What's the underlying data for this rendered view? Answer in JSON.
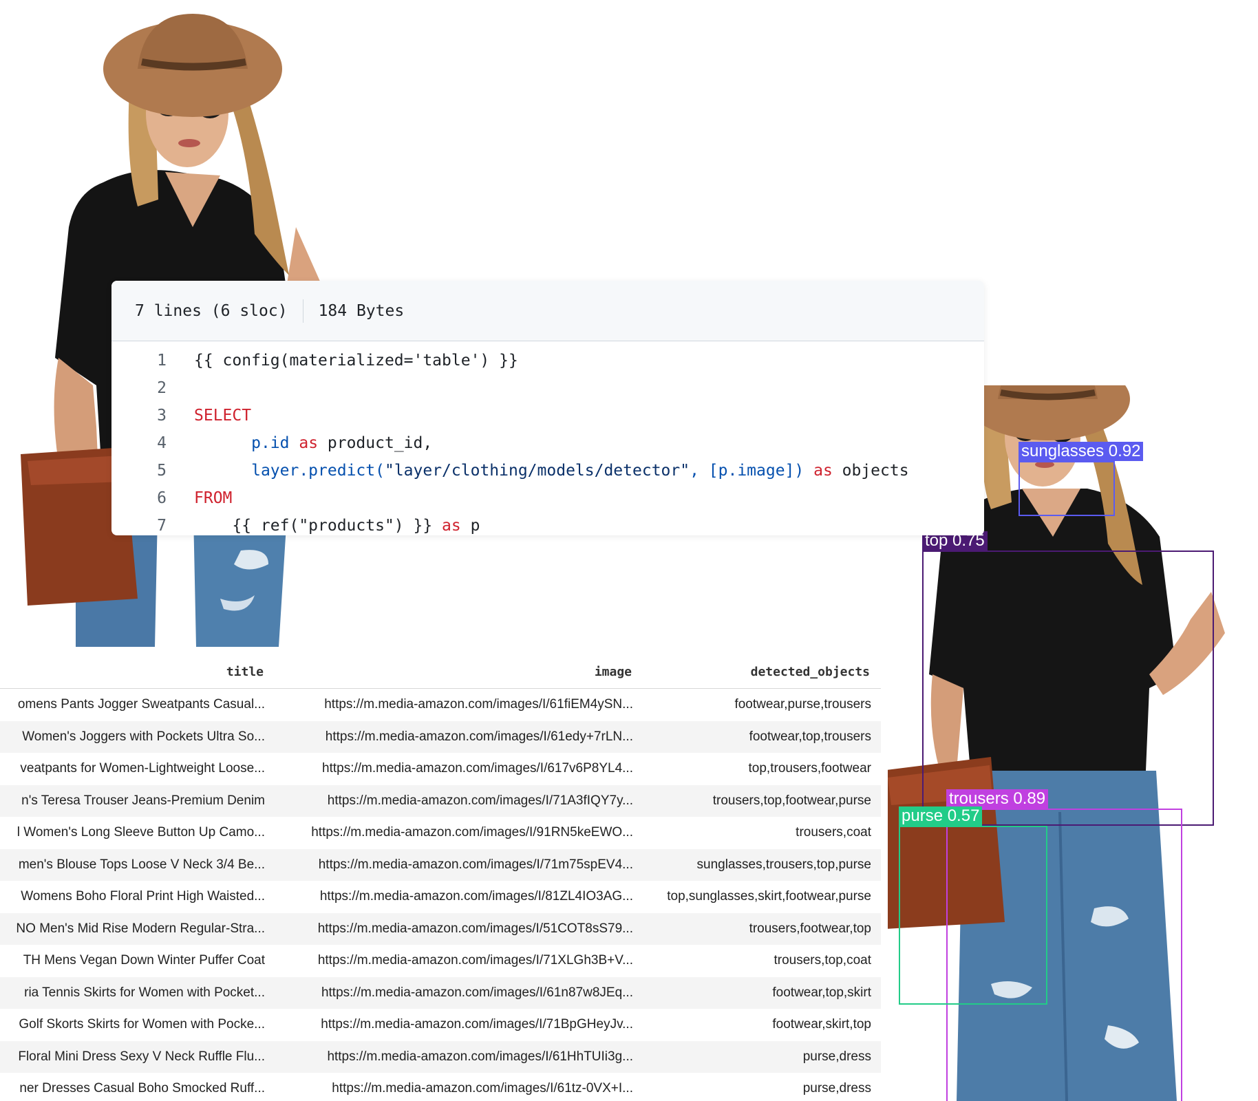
{
  "code_file": {
    "lines_info": "7 lines (6 sloc)",
    "size": "184 Bytes",
    "lines": [
      {
        "num": "1",
        "indent": "",
        "parts": [
          {
            "t": "{{ config(materialized='table') }}",
            "c": ""
          }
        ]
      },
      {
        "num": "2",
        "indent": "",
        "parts": []
      },
      {
        "num": "3",
        "indent": "",
        "parts": [
          {
            "t": "SELECT",
            "c": "kw"
          }
        ]
      },
      {
        "num": "4",
        "indent": "      ",
        "parts": [
          {
            "t": "p.id ",
            "c": "fn"
          },
          {
            "t": "as",
            "c": "kw"
          },
          {
            "t": " product_id,",
            "c": ""
          }
        ]
      },
      {
        "num": "5",
        "indent": "      ",
        "parts": [
          {
            "t": "layer.predict(",
            "c": "fn"
          },
          {
            "t": "\"layer/clothing/models/detector\"",
            "c": "str"
          },
          {
            "t": ", [p.image]) ",
            "c": "fn"
          },
          {
            "t": "as",
            "c": "kw"
          },
          {
            "t": " objects",
            "c": ""
          }
        ]
      },
      {
        "num": "6",
        "indent": "",
        "parts": [
          {
            "t": "FROM",
            "c": "kw"
          }
        ]
      },
      {
        "num": "7",
        "indent": "    ",
        "parts": [
          {
            "t": "{{ ref(\"products\") }} ",
            "c": ""
          },
          {
            "t": "as",
            "c": "kw"
          },
          {
            "t": " p",
            "c": ""
          }
        ]
      }
    ]
  },
  "table": {
    "headers": {
      "title": "title",
      "image": "image",
      "detected_objects": "detected_objects"
    },
    "rows": [
      {
        "title": "omens Pants Jogger Sweatpants Casual...",
        "image": "https://m.media-amazon.com/images/I/61fiEM4ySN...",
        "detected_objects": "footwear,purse,trousers"
      },
      {
        "title": "Women's Joggers with Pockets Ultra So...",
        "image": "https://m.media-amazon.com/images/I/61edy+7rLN...",
        "detected_objects": "footwear,top,trousers"
      },
      {
        "title": "veatpants for Women-Lightweight Loose...",
        "image": "https://m.media-amazon.com/images/I/617v6P8YL4...",
        "detected_objects": "top,trousers,footwear"
      },
      {
        "title": "n's Teresa Trouser Jeans-Premium Denim",
        "image": "https://m.media-amazon.com/images/I/71A3fIQY7y...",
        "detected_objects": "trousers,top,footwear,purse"
      },
      {
        "title": "l Women's Long Sleeve Button Up Camo...",
        "image": "https://m.media-amazon.com/images/I/91RN5keEWO...",
        "detected_objects": "trousers,coat"
      },
      {
        "title": "men's Blouse Tops Loose V Neck 3/4 Be...",
        "image": "https://m.media-amazon.com/images/I/71m75spEV4...",
        "detected_objects": "sunglasses,trousers,top,purse"
      },
      {
        "title": "Womens Boho Floral Print High Waisted...",
        "image": "https://m.media-amazon.com/images/I/81ZL4IO3AG...",
        "detected_objects": "top,sunglasses,skirt,footwear,purse"
      },
      {
        "title": "NO Men's Mid Rise Modern Regular-Stra...",
        "image": "https://m.media-amazon.com/images/I/51COT8sS79...",
        "detected_objects": "trousers,footwear,top"
      },
      {
        "title": "TH Mens Vegan Down Winter Puffer Coat",
        "image": "https://m.media-amazon.com/images/I/71XLGh3B+V...",
        "detected_objects": "trousers,top,coat"
      },
      {
        "title": "ria Tennis Skirts for Women with Pocket...",
        "image": "https://m.media-amazon.com/images/I/61n87w8JEq...",
        "detected_objects": "footwear,top,skirt"
      },
      {
        "title": "Golf Skorts Skirts for Women with Pocke...",
        "image": "https://m.media-amazon.com/images/I/71BpGHeyJv...",
        "detected_objects": "footwear,skirt,top"
      },
      {
        "title": "Floral Mini Dress Sexy V Neck Ruffle Flu...",
        "image": "https://m.media-amazon.com/images/I/61HhTUIi3g...",
        "detected_objects": "purse,dress"
      },
      {
        "title": "ner Dresses Casual Boho Smocked Ruff...",
        "image": "https://m.media-amazon.com/images/I/61tz-0VX+I...",
        "detected_objects": "purse,dress"
      }
    ]
  },
  "detections": [
    {
      "key": "sunglasses",
      "label": "sunglasses 0.92",
      "color": "#5b5bf0"
    },
    {
      "key": "top",
      "label": "top 0.75",
      "color": "#4b1a73"
    },
    {
      "key": "trousers",
      "label": "trousers 0.89",
      "color": "#c040e0"
    },
    {
      "key": "purse",
      "label": "purse 0.57",
      "color": "#22cc88"
    }
  ]
}
